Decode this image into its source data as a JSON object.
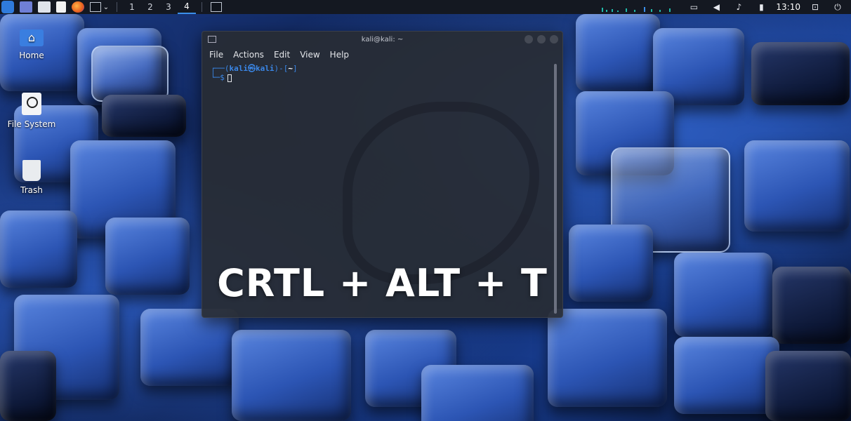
{
  "taskbar": {
    "workspaces": [
      "1",
      "2",
      "3",
      "4"
    ],
    "active_workspace": "4",
    "clock": "13:10",
    "icons": [
      "kali-menu-icon",
      "desktop-icon",
      "file-manager-icon",
      "text-editor-icon",
      "firefox-icon",
      "terminal-icon",
      "chevron-down-icon",
      "terminal-icon",
      "monitor-icon",
      "volume-icon",
      "bell-icon",
      "battery-icon",
      "lock-icon",
      "logout-icon"
    ]
  },
  "desktop": {
    "icons": [
      {
        "label": "Home",
        "icon": "home-folder-icon"
      },
      {
        "label": "File System",
        "icon": "drive-icon"
      },
      {
        "label": "Trash",
        "icon": "trash-icon"
      }
    ]
  },
  "terminal": {
    "title": "kali@kali: ~",
    "menu": [
      "File",
      "Actions",
      "Edit",
      "View",
      "Help"
    ],
    "prompt": {
      "line1_open": "┌──(",
      "user": "kali㉿kali",
      "line1_mid": ")-[",
      "dir": "~",
      "line1_close": "]",
      "line2": "└─$"
    }
  },
  "overlay": {
    "caption": "CRTL + ALT + T"
  }
}
